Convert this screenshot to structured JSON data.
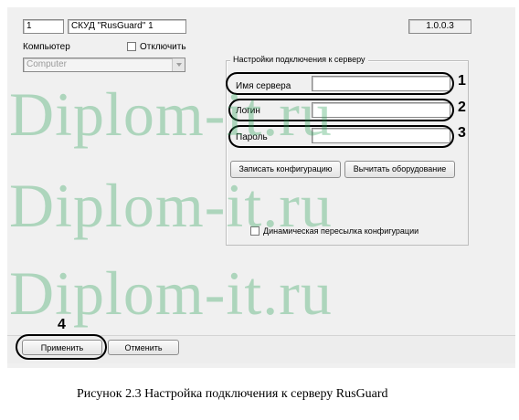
{
  "object": {
    "id": "1",
    "name": "СКУД \"RusGuard\" 1"
  },
  "computer": {
    "label": "Компьютер",
    "disable_label": "Отключить",
    "value": "Computer"
  },
  "version": "1.0.0.3",
  "connection": {
    "legend": "Настройки подключения к серверу",
    "server_label": "Имя сервера",
    "server_value": "",
    "login_label": "Логин",
    "login_value": "",
    "password_label": "Пароль",
    "password_value": "",
    "write_config_label": "Записать конфигурацию",
    "read_hardware_label": "Вычитать оборудование",
    "dynamic_label": "Динамическая пересылка конфигурации"
  },
  "footer": {
    "apply_label": "Применить",
    "cancel_label": "Отменить"
  },
  "callouts": [
    "1",
    "2",
    "3",
    "4"
  ],
  "watermark": "Diplom-it.ru",
  "caption": "Рисунок 2.3 Настройка подключения к серверу RusGuard",
  "colors": {
    "watermark": "#2ea35b",
    "panel": "#f0f0f0"
  }
}
